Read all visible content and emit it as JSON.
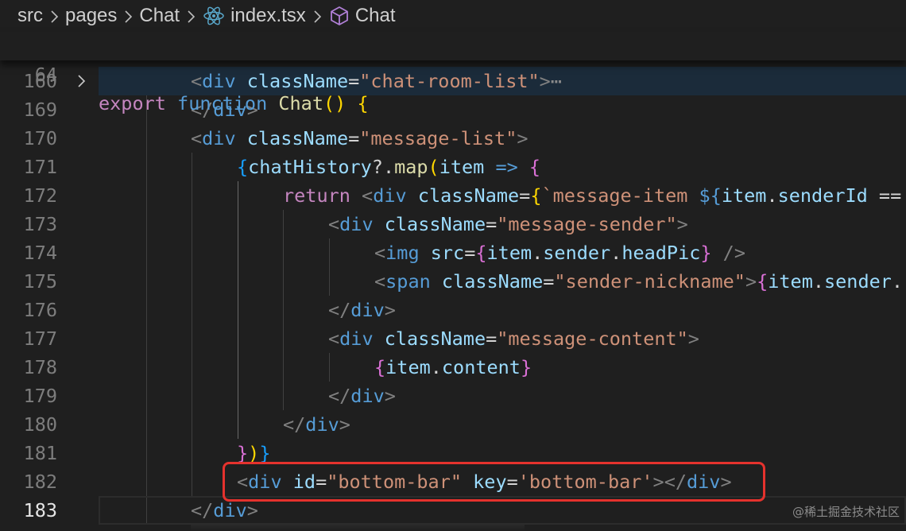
{
  "breadcrumb": {
    "items": [
      "src",
      "pages",
      "Chat",
      "index.tsx",
      "Chat"
    ],
    "icons": [
      "react-icon",
      "cube-icon"
    ]
  },
  "sticky": {
    "line_number": "64",
    "tokens": [
      {
        "t": "export",
        "c": "kw"
      },
      {
        "t": " ",
        "c": "plain"
      },
      {
        "t": "function",
        "c": "kw2"
      },
      {
        "t": " ",
        "c": "plain"
      },
      {
        "t": "Chat",
        "c": "fn"
      },
      {
        "t": "()",
        "c": "b1"
      },
      {
        "t": " ",
        "c": "plain"
      },
      {
        "t": "{",
        "c": "b1"
      }
    ]
  },
  "lines": [
    {
      "n": "160",
      "folded": true,
      "tokens": [
        {
          "t": "<",
          "c": "lt"
        },
        {
          "t": "div",
          "c": "tag"
        },
        {
          "t": " ",
          "c": "plain"
        },
        {
          "t": "className",
          "c": "attr"
        },
        {
          "t": "=",
          "c": "plain"
        },
        {
          "t": "\"chat-room-list\"",
          "c": "str"
        },
        {
          "t": ">",
          "c": "lt"
        },
        {
          "t": "⋯",
          "c": "ell"
        }
      ]
    },
    {
      "n": "169",
      "tokens": [
        {
          "t": "</",
          "c": "lt"
        },
        {
          "t": "div",
          "c": "tag"
        },
        {
          "t": ">",
          "c": "lt"
        }
      ]
    },
    {
      "n": "170",
      "tokens": [
        {
          "t": "<",
          "c": "lt"
        },
        {
          "t": "div",
          "c": "tag"
        },
        {
          "t": " ",
          "c": "plain"
        },
        {
          "t": "className",
          "c": "attr"
        },
        {
          "t": "=",
          "c": "plain"
        },
        {
          "t": "\"message-list\"",
          "c": "str"
        },
        {
          "t": ">",
          "c": "lt"
        }
      ]
    },
    {
      "n": "171",
      "tokens": [
        {
          "t": "{",
          "c": "b3"
        },
        {
          "t": "chatHistory",
          "c": "var"
        },
        {
          "t": "?.",
          "c": "plain"
        },
        {
          "t": "map",
          "c": "fn"
        },
        {
          "t": "(",
          "c": "b1"
        },
        {
          "t": "item",
          "c": "var"
        },
        {
          "t": " => ",
          "c": "kw2"
        },
        {
          "t": "{",
          "c": "b2"
        }
      ]
    },
    {
      "n": "172",
      "tokens": [
        {
          "t": "return",
          "c": "kw"
        },
        {
          "t": " ",
          "c": "plain"
        },
        {
          "t": "<",
          "c": "lt"
        },
        {
          "t": "div",
          "c": "tag"
        },
        {
          "t": " ",
          "c": "plain"
        },
        {
          "t": "className",
          "c": "attr"
        },
        {
          "t": "=",
          "c": "plain"
        },
        {
          "t": "{",
          "c": "b1"
        },
        {
          "t": "`message-item ",
          "c": "str"
        },
        {
          "t": "${",
          "c": "kw2"
        },
        {
          "t": "item",
          "c": "var"
        },
        {
          "t": ".",
          "c": "plain"
        },
        {
          "t": "senderId",
          "c": "var"
        },
        {
          "t": " ==",
          "c": "plain"
        }
      ]
    },
    {
      "n": "173",
      "tokens": [
        {
          "t": "<",
          "c": "lt"
        },
        {
          "t": "div",
          "c": "tag"
        },
        {
          "t": " ",
          "c": "plain"
        },
        {
          "t": "className",
          "c": "attr"
        },
        {
          "t": "=",
          "c": "plain"
        },
        {
          "t": "\"message-sender\"",
          "c": "str"
        },
        {
          "t": ">",
          "c": "lt"
        }
      ]
    },
    {
      "n": "174",
      "tokens": [
        {
          "t": "<",
          "c": "lt"
        },
        {
          "t": "img",
          "c": "tag"
        },
        {
          "t": " ",
          "c": "plain"
        },
        {
          "t": "src",
          "c": "attr"
        },
        {
          "t": "=",
          "c": "plain"
        },
        {
          "t": "{",
          "c": "b2"
        },
        {
          "t": "item",
          "c": "var"
        },
        {
          "t": ".",
          "c": "plain"
        },
        {
          "t": "sender",
          "c": "var"
        },
        {
          "t": ".",
          "c": "plain"
        },
        {
          "t": "headPic",
          "c": "var"
        },
        {
          "t": "}",
          "c": "b2"
        },
        {
          "t": " />",
          "c": "lt"
        }
      ]
    },
    {
      "n": "175",
      "tokens": [
        {
          "t": "<",
          "c": "lt"
        },
        {
          "t": "span",
          "c": "tag"
        },
        {
          "t": " ",
          "c": "plain"
        },
        {
          "t": "className",
          "c": "attr"
        },
        {
          "t": "=",
          "c": "plain"
        },
        {
          "t": "\"sender-nickname\"",
          "c": "str"
        },
        {
          "t": ">",
          "c": "lt"
        },
        {
          "t": "{",
          "c": "b2"
        },
        {
          "t": "item",
          "c": "var"
        },
        {
          "t": ".",
          "c": "plain"
        },
        {
          "t": "sender",
          "c": "var"
        },
        {
          "t": ".",
          "c": "plain"
        }
      ]
    },
    {
      "n": "176",
      "tokens": [
        {
          "t": "</",
          "c": "lt"
        },
        {
          "t": "div",
          "c": "tag"
        },
        {
          "t": ">",
          "c": "lt"
        }
      ]
    },
    {
      "n": "177",
      "tokens": [
        {
          "t": "<",
          "c": "lt"
        },
        {
          "t": "div",
          "c": "tag"
        },
        {
          "t": " ",
          "c": "plain"
        },
        {
          "t": "className",
          "c": "attr"
        },
        {
          "t": "=",
          "c": "plain"
        },
        {
          "t": "\"message-content\"",
          "c": "str"
        },
        {
          "t": ">",
          "c": "lt"
        }
      ]
    },
    {
      "n": "178",
      "tokens": [
        {
          "t": "{",
          "c": "b2"
        },
        {
          "t": "item",
          "c": "var"
        },
        {
          "t": ".",
          "c": "plain"
        },
        {
          "t": "content",
          "c": "var"
        },
        {
          "t": "}",
          "c": "b2"
        }
      ]
    },
    {
      "n": "179",
      "tokens": [
        {
          "t": "</",
          "c": "lt"
        },
        {
          "t": "div",
          "c": "tag"
        },
        {
          "t": ">",
          "c": "lt"
        }
      ]
    },
    {
      "n": "180",
      "tokens": [
        {
          "t": "</",
          "c": "lt"
        },
        {
          "t": "div",
          "c": "tag"
        },
        {
          "t": ">",
          "c": "lt"
        }
      ]
    },
    {
      "n": "181",
      "tokens": [
        {
          "t": "}",
          "c": "b2"
        },
        {
          "t": ")",
          "c": "b1"
        },
        {
          "t": "}",
          "c": "b3"
        }
      ]
    },
    {
      "n": "182",
      "tokens": [
        {
          "t": "<",
          "c": "lt"
        },
        {
          "t": "div",
          "c": "tag"
        },
        {
          "t": " ",
          "c": "plain"
        },
        {
          "t": "id",
          "c": "attr"
        },
        {
          "t": "=",
          "c": "plain"
        },
        {
          "t": "\"bottom-bar\"",
          "c": "str"
        },
        {
          "t": " ",
          "c": "plain"
        },
        {
          "t": "key",
          "c": "attr"
        },
        {
          "t": "=",
          "c": "plain"
        },
        {
          "t": "'bottom-bar'",
          "c": "str"
        },
        {
          "t": "></",
          "c": "lt"
        },
        {
          "t": "div",
          "c": "tag"
        },
        {
          "t": ">",
          "c": "lt"
        }
      ]
    },
    {
      "n": "183",
      "active": true,
      "tokens": [
        {
          "t": "</",
          "c": "lt"
        },
        {
          "t": "div",
          "c": "tag"
        },
        {
          "t": ">",
          "c": "lt"
        }
      ]
    }
  ],
  "watermark": "@稀土掘金技术社区"
}
